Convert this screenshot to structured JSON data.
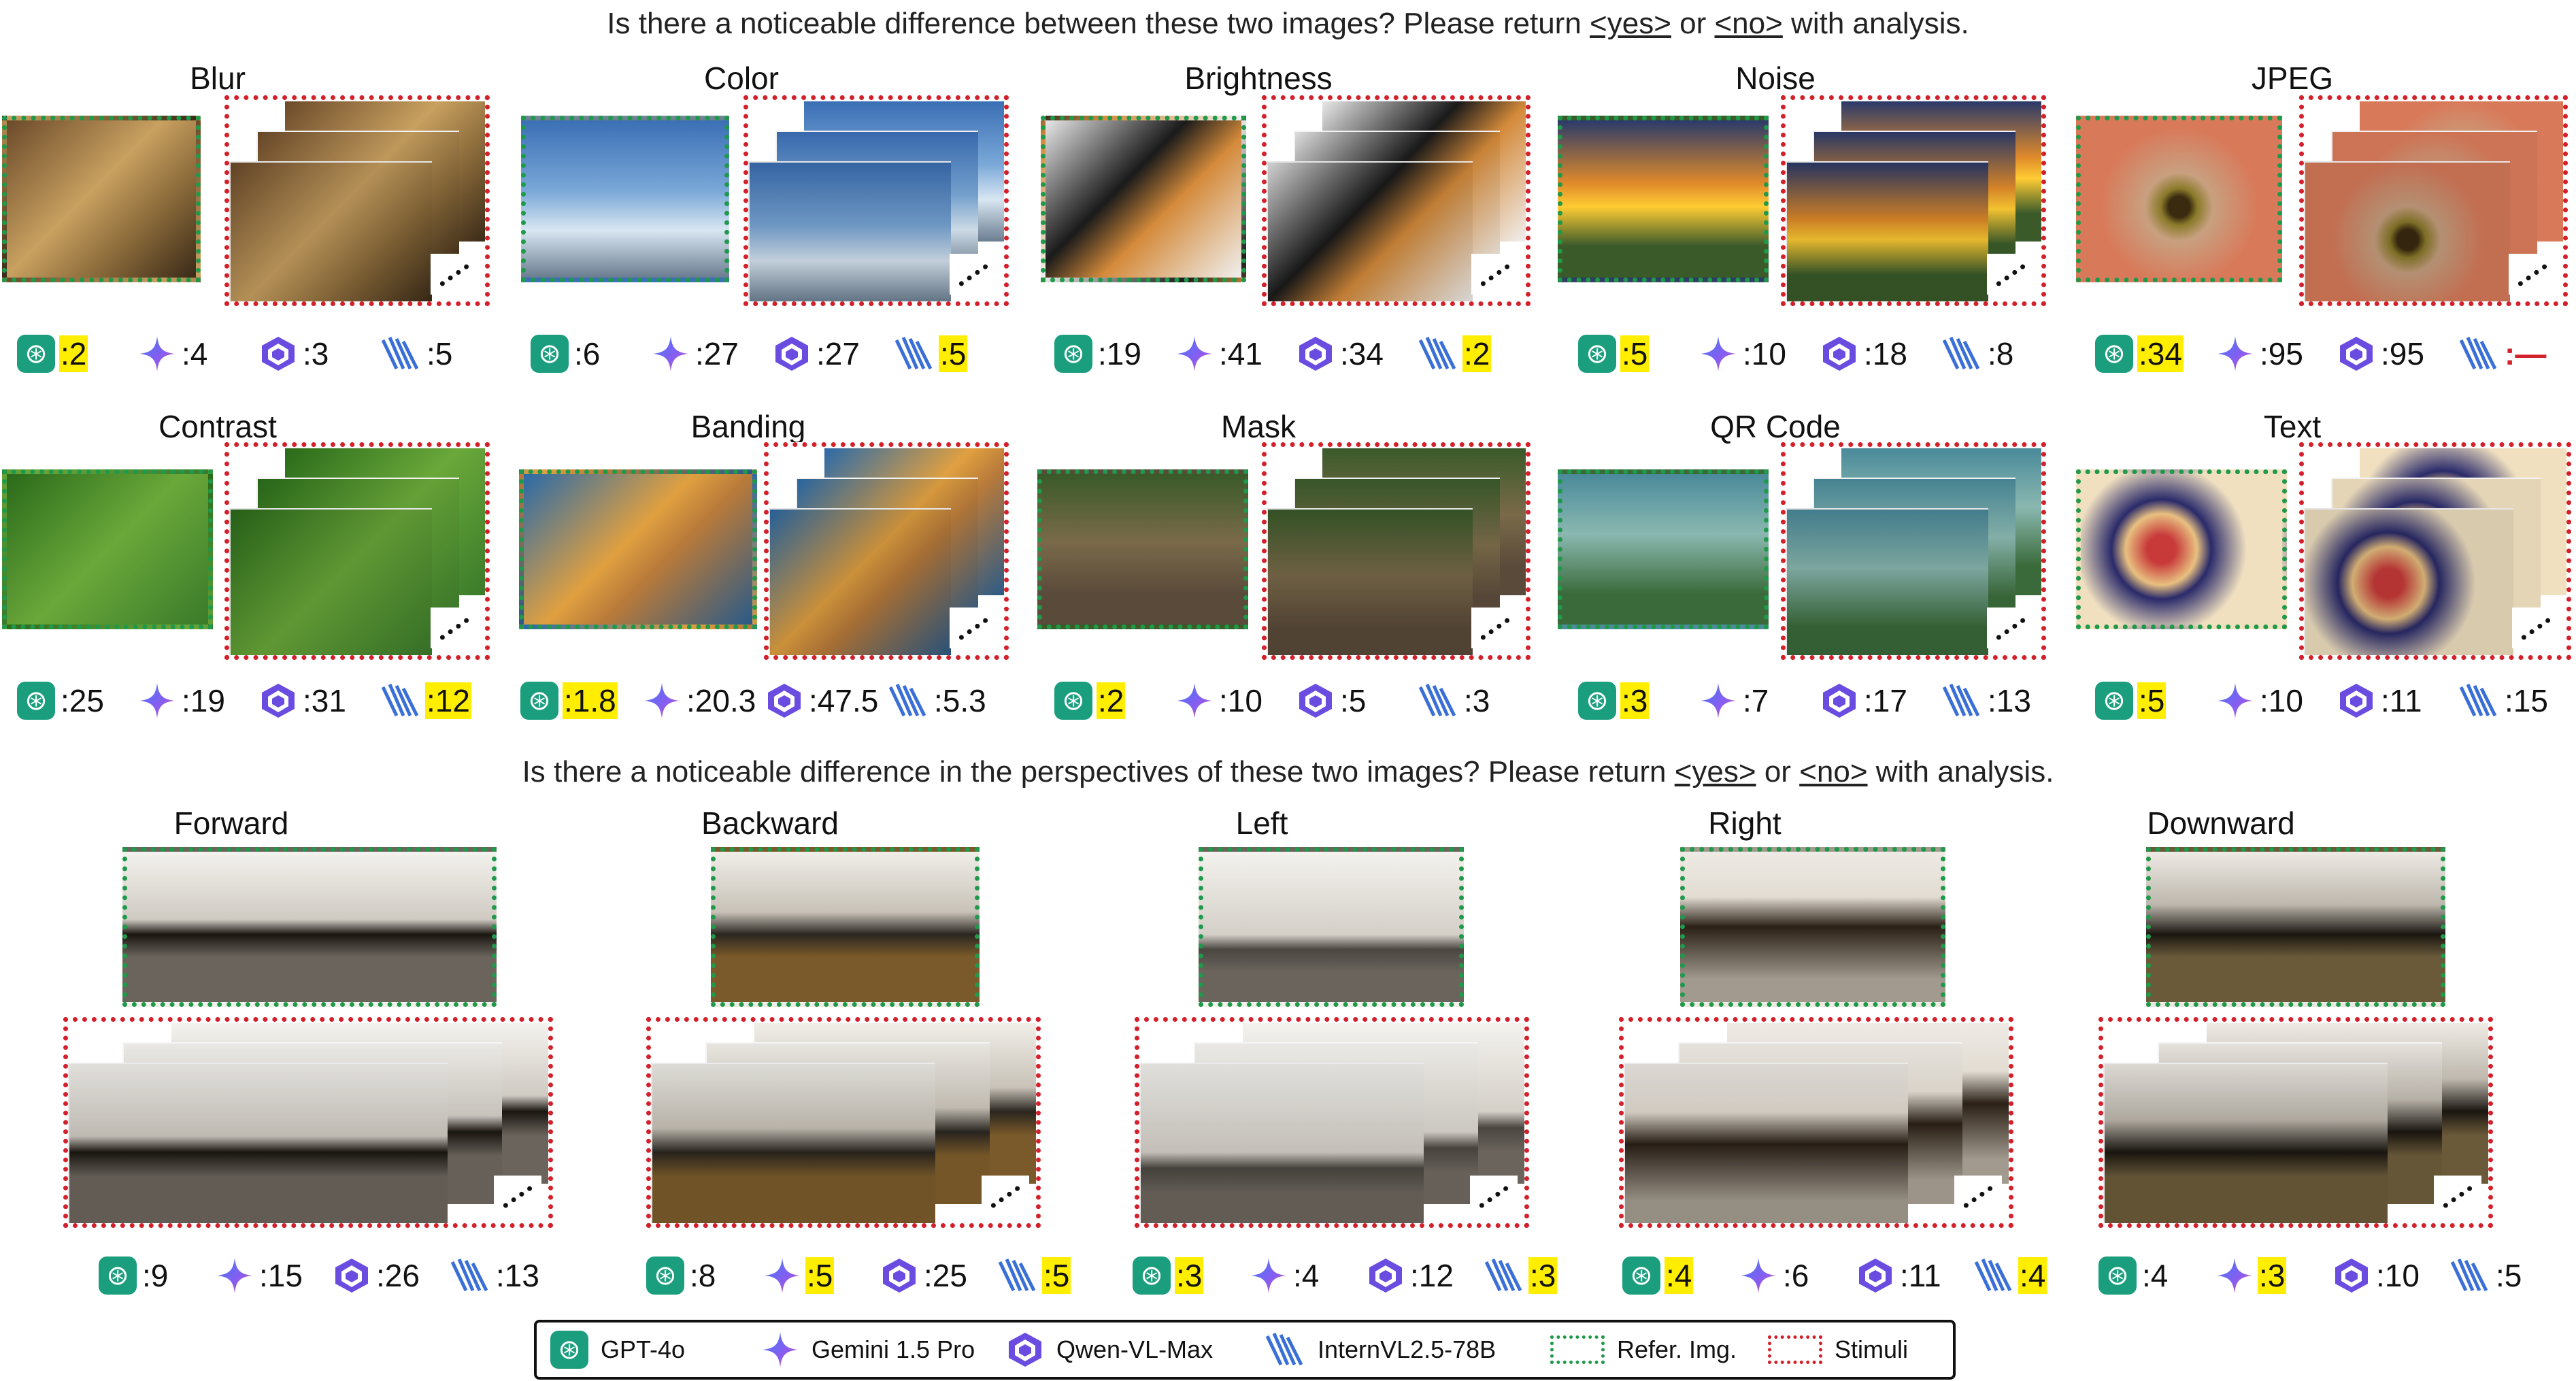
{
  "questions": {
    "q1_pre": "Is there a noticeable difference between these two images? Please return ",
    "q1_yes": "<yes>",
    "q1_or": " or ",
    "q1_no": "<no>",
    "q1_post": " with analysis.",
    "q2_pre": "Is there a noticeable difference in the perspectives of these two images? Please return ",
    "q2_yes": "<yes>",
    "q2_or": " or ",
    "q2_no": "<no>",
    "q2_post": " with analysis."
  },
  "row1": [
    {
      "title": "Blur",
      "scores": [
        ":2",
        ":4",
        ":3",
        ":5"
      ],
      "hl": [
        true,
        false,
        false,
        false
      ]
    },
    {
      "title": "Color",
      "scores": [
        ":6",
        ":27",
        ":27",
        ":5"
      ],
      "hl": [
        false,
        false,
        false,
        true
      ]
    },
    {
      "title": "Brightness",
      "scores": [
        ":19",
        ":41",
        ":34",
        ":2"
      ],
      "hl": [
        false,
        false,
        false,
        true
      ]
    },
    {
      "title": "Noise",
      "scores": [
        ":5",
        ":10",
        ":18",
        ":8"
      ],
      "hl": [
        true,
        false,
        false,
        false
      ]
    },
    {
      "title": "JPEG",
      "scores": [
        ":34",
        ":95",
        ":95",
        ":—"
      ],
      "hl": [
        true,
        false,
        false,
        false
      ]
    }
  ],
  "row2": [
    {
      "title": "Contrast",
      "scores": [
        ":25",
        ":19",
        ":31",
        ":12"
      ],
      "hl": [
        false,
        false,
        false,
        true
      ]
    },
    {
      "title": "Banding",
      "scores": [
        ":1.8",
        ":20.3",
        ":47.5",
        ":5.3"
      ],
      "hl": [
        true,
        false,
        false,
        false
      ]
    },
    {
      "title": "Mask",
      "scores": [
        ":2",
        ":10",
        ":5",
        ":3"
      ],
      "hl": [
        true,
        false,
        false,
        false
      ]
    },
    {
      "title": "QR Code",
      "scores": [
        ":3",
        ":7",
        ":17",
        ":13"
      ],
      "hl": [
        true,
        false,
        false,
        false
      ]
    },
    {
      "title": "Text",
      "scores": [
        ":5",
        ":10",
        ":11",
        ":15"
      ],
      "hl": [
        true,
        false,
        false,
        false
      ]
    }
  ],
  "row3": [
    {
      "title": "Forward",
      "scores": [
        ":9",
        ":15",
        ":26",
        ":13"
      ],
      "hl": [
        false,
        false,
        false,
        false
      ]
    },
    {
      "title": "Backward",
      "scores": [
        ":8",
        ":5",
        ":25",
        ":5"
      ],
      "hl": [
        false,
        true,
        false,
        true
      ]
    },
    {
      "title": "Left",
      "scores": [
        ":3",
        ":4",
        ":12",
        ":3"
      ],
      "hl": [
        true,
        false,
        false,
        true
      ]
    },
    {
      "title": "Right",
      "scores": [
        ":4",
        ":6",
        ":11",
        ":4"
      ],
      "hl": [
        true,
        false,
        false,
        true
      ]
    },
    {
      "title": "Downward",
      "scores": [
        ":4",
        ":3",
        ":10",
        ":5"
      ],
      "hl": [
        false,
        true,
        false,
        false
      ]
    }
  ],
  "legend": {
    "gpt": "GPT-4o",
    "gemini": "Gemini 1.5 Pro",
    "qwen": "Qwen-VL-Max",
    "intern": "InternVL2.5-78B",
    "ref": "Refer. Img.",
    "stim": "Stimuli"
  },
  "colors": {
    "ref_border": "#1e9a4a",
    "stim_border": "#d3202a",
    "highlight": "#ffee00",
    "gpt": "#1a9e7e",
    "gemini": "#4a6cf7",
    "qwen": "#6a4de0",
    "intern": "#3a6fd8"
  },
  "icons": [
    "gpt-icon",
    "gemini-icon",
    "qwen-icon",
    "internvl-icon"
  ]
}
